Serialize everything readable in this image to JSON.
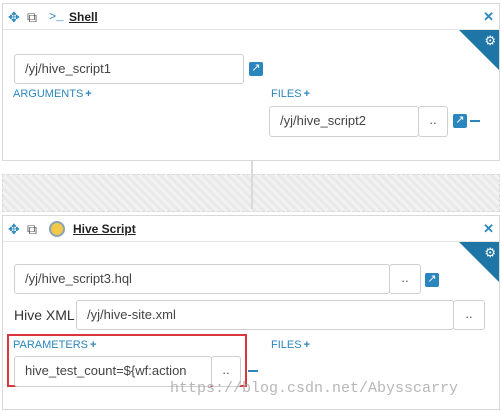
{
  "shell": {
    "title": "Shell",
    "prompt_glyph": ">_",
    "script_path": "/yj/hive_script1",
    "arguments_label": "ARGUMENTS",
    "files_label": "FILES",
    "file_value": "/yj/hive_script2",
    "browse_label": ".."
  },
  "hive": {
    "title": "Hive Script",
    "script_path": "/yj/hive_script3.hql",
    "browse_label": "..",
    "xml_label": "Hive XML",
    "xml_value": "/yj/hive-site.xml",
    "xml_browse_label": "..",
    "parameters_label": "PARAMETERS",
    "files_label": "FILES",
    "param_value": "hive_test_count=${wf:action",
    "param_browse_label": ".."
  },
  "watermark": "https://blog.csdn.net/Abysscarry",
  "colors": {
    "accent": "#2b86bd",
    "corner": "#1f75a5",
    "highlight": "#d9363e"
  }
}
